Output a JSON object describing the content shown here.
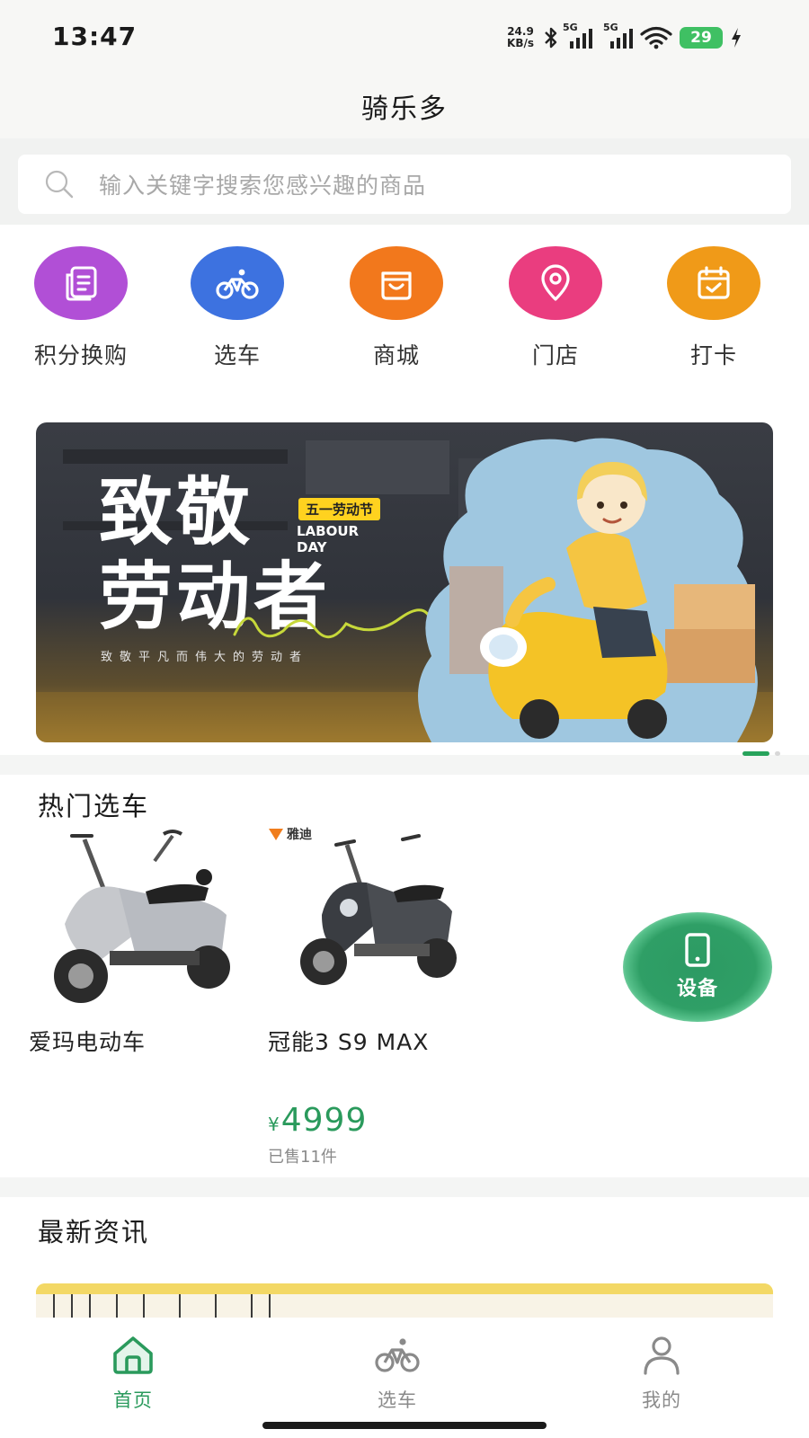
{
  "status_bar": {
    "time": "13:47",
    "net_speed_value": "24.9",
    "net_speed_unit": "KB/s",
    "signal1_tag": "5G",
    "signal2_tag": "5G",
    "battery": "29",
    "icons": [
      "bluetooth-icon",
      "signal-icon",
      "wifi-icon",
      "battery-icon",
      "charging-icon"
    ]
  },
  "header": {
    "title": "骑乐多"
  },
  "search": {
    "placeholder": "输入关键字搜索您感兴趣的商品"
  },
  "quick_nav": [
    {
      "label": "积分换购",
      "icon": "points-exchange-icon",
      "color": "#b14fd6"
    },
    {
      "label": "选车",
      "icon": "bicycle-icon",
      "color": "#3d72e0"
    },
    {
      "label": "商城",
      "icon": "shopping-bag-icon",
      "color": "#f2781c"
    },
    {
      "label": "门店",
      "icon": "location-pin-icon",
      "color": "#ea3d7f"
    },
    {
      "label": "打卡",
      "icon": "calendar-check-icon",
      "color": "#f09a18"
    }
  ],
  "banner": {
    "title_line1": "致敬",
    "title_line2": "劳动者",
    "badge": "五一劳动节",
    "english_line1": "LABOUR",
    "english_line2": "DAY",
    "subtitle": "致敬平凡而伟大的劳动者"
  },
  "hot_section": {
    "title": "热门选车",
    "products": [
      {
        "name": "爱玛电动车"
      },
      {
        "name": "冠能3 S9 MAX",
        "brand": "雅迪",
        "price_symbol": "¥",
        "price": "4999",
        "sold": "已售11件"
      }
    ]
  },
  "device_button": {
    "label": "设备",
    "icon": "tablet-device-icon"
  },
  "news_section": {
    "title": "最新资讯"
  },
  "tabbar": {
    "items": [
      {
        "label": "首页",
        "icon": "home-icon",
        "active": true
      },
      {
        "label": "选车",
        "icon": "bicycle-icon",
        "active": false
      },
      {
        "label": "我的",
        "icon": "user-icon",
        "active": false
      }
    ],
    "active_color": "#2a9a5c",
    "inactive_color": "#8a8a8a"
  }
}
